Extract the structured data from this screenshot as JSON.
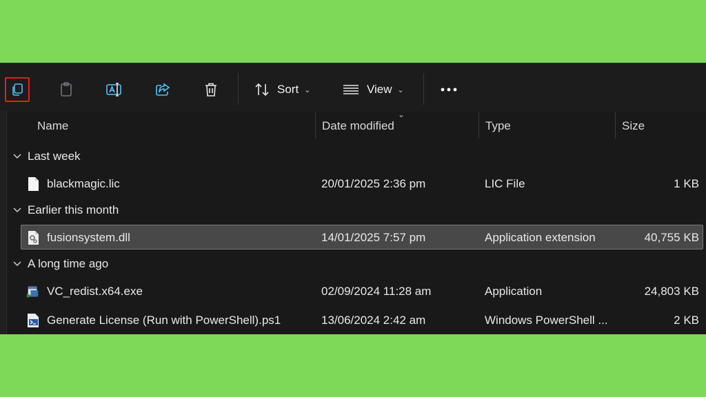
{
  "toolbar": {
    "sort_label": "Sort",
    "view_label": "View"
  },
  "columns": {
    "name": "Name",
    "date": "Date modified",
    "type": "Type",
    "size": "Size"
  },
  "groups": [
    {
      "label": "Last week"
    },
    {
      "label": "Earlier this month"
    },
    {
      "label": "A long time ago"
    }
  ],
  "files": [
    {
      "name": "blackmagic.lic",
      "date": "20/01/2025 2:36 pm",
      "type": "LIC File",
      "size": "1 KB",
      "icon": "document-icon"
    },
    {
      "name": "fusionsystem.dll",
      "date": "14/01/2025 7:57 pm",
      "type": "Application extension",
      "size": "40,755 KB",
      "icon": "dll-icon"
    },
    {
      "name": "VC_redist.x64.exe",
      "date": "02/09/2024 11:28 am",
      "type": "Application",
      "size": "24,803 KB",
      "icon": "installer-icon"
    },
    {
      "name": "Generate License (Run with PowerShell).ps1",
      "date": "13/06/2024 2:42 am",
      "type": "Windows PowerShell ...",
      "size": "2 KB",
      "icon": "powershell-script-icon"
    }
  ],
  "colors": {
    "background": "#7ed957",
    "window": "#191919",
    "selection_outline": "#e0211b",
    "selected_row": "#484848"
  }
}
